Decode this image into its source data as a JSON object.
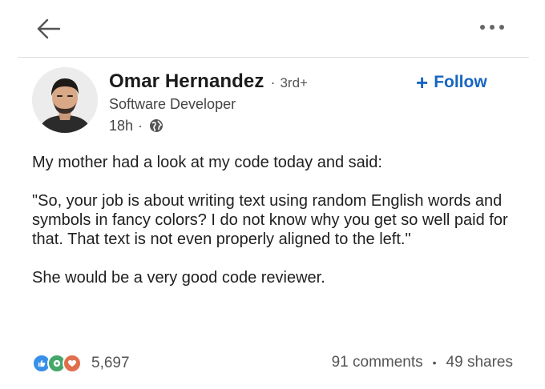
{
  "header": {
    "back_icon": "arrow-left-icon",
    "more_icon": "more-horizontal-icon"
  },
  "author": {
    "name": "Omar Hernandez",
    "separator": "·",
    "degree": "3rd+",
    "headline": "Software Developer",
    "time": "18h",
    "visibility_icon": "globe-icon"
  },
  "follow": {
    "plus": "+",
    "label": "Follow",
    "color": "#1666c2"
  },
  "post": {
    "paragraphs": [
      "My mother had a look at my code today and said:",
      "\"So, your job is about writing text using random English words and symbols in fancy colors? I do not know why you get so well paid for that. That text is not even properly aligned to the left.\"",
      "She would be a very good code reviewer."
    ]
  },
  "social": {
    "reaction_icons": [
      "like-icon",
      "celebrate-icon",
      "love-icon"
    ],
    "reaction_count": "5,697",
    "comments": "91 comments",
    "bullet": "•",
    "shares": "49 shares"
  }
}
